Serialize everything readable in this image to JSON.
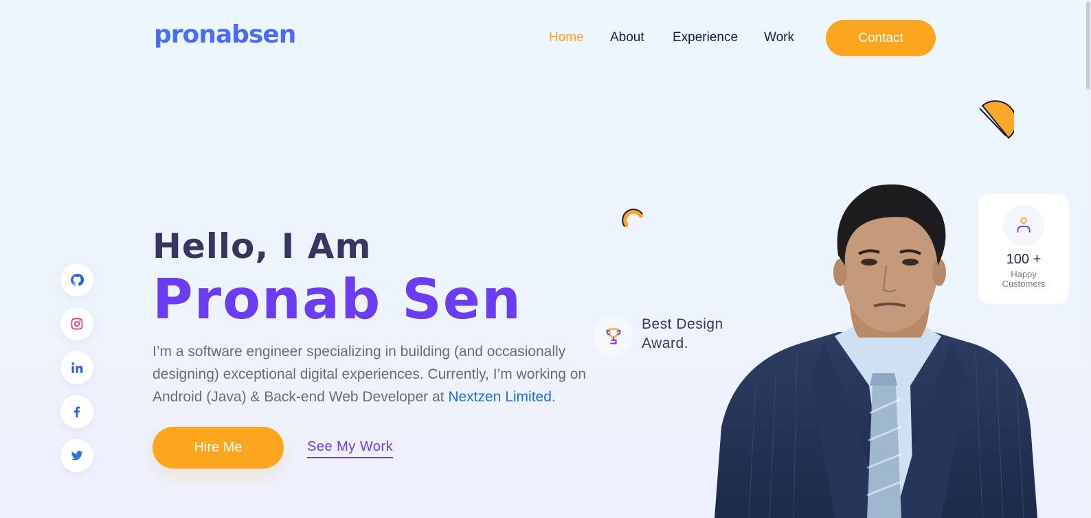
{
  "brand": {
    "logo_text": "pronabsen",
    "accent": "#6c3cf4",
    "orange": "#fca61f",
    "logo_color": "#4b6cf5"
  },
  "nav": {
    "items": [
      {
        "label": "Home",
        "active": true
      },
      {
        "label": "About",
        "active": false
      },
      {
        "label": "Experience",
        "active": false
      },
      {
        "label": "Work",
        "active": false
      }
    ],
    "contact_label": "Contact"
  },
  "social": {
    "items": [
      {
        "name": "github",
        "icon": "github-icon"
      },
      {
        "name": "instagram",
        "icon": "instagram-icon"
      },
      {
        "name": "linkedin",
        "icon": "linkedin-icon"
      },
      {
        "name": "facebook",
        "icon": "facebook-icon"
      },
      {
        "name": "twitter",
        "icon": "twitter-icon"
      }
    ]
  },
  "hero": {
    "greeting": "Hello, I Am",
    "name": "Pronab Sen",
    "description_before": "I’m a software engineer specializing in building (and occasionally designing) exceptional digital experiences. Currently, I’m working on Android (Java) & Back-end Web Developer at ",
    "company": "Nextzen Limited",
    "description_after": ".",
    "hire_label": "Hire Me",
    "see_work_label": "See My Work"
  },
  "award": {
    "line1": "Best Design",
    "line2": "Award.",
    "icon": "trophy-icon"
  },
  "stats": {
    "count": "100 +",
    "label_line1": "Happy",
    "label_line2": "Customers",
    "icon": "user-icon"
  }
}
